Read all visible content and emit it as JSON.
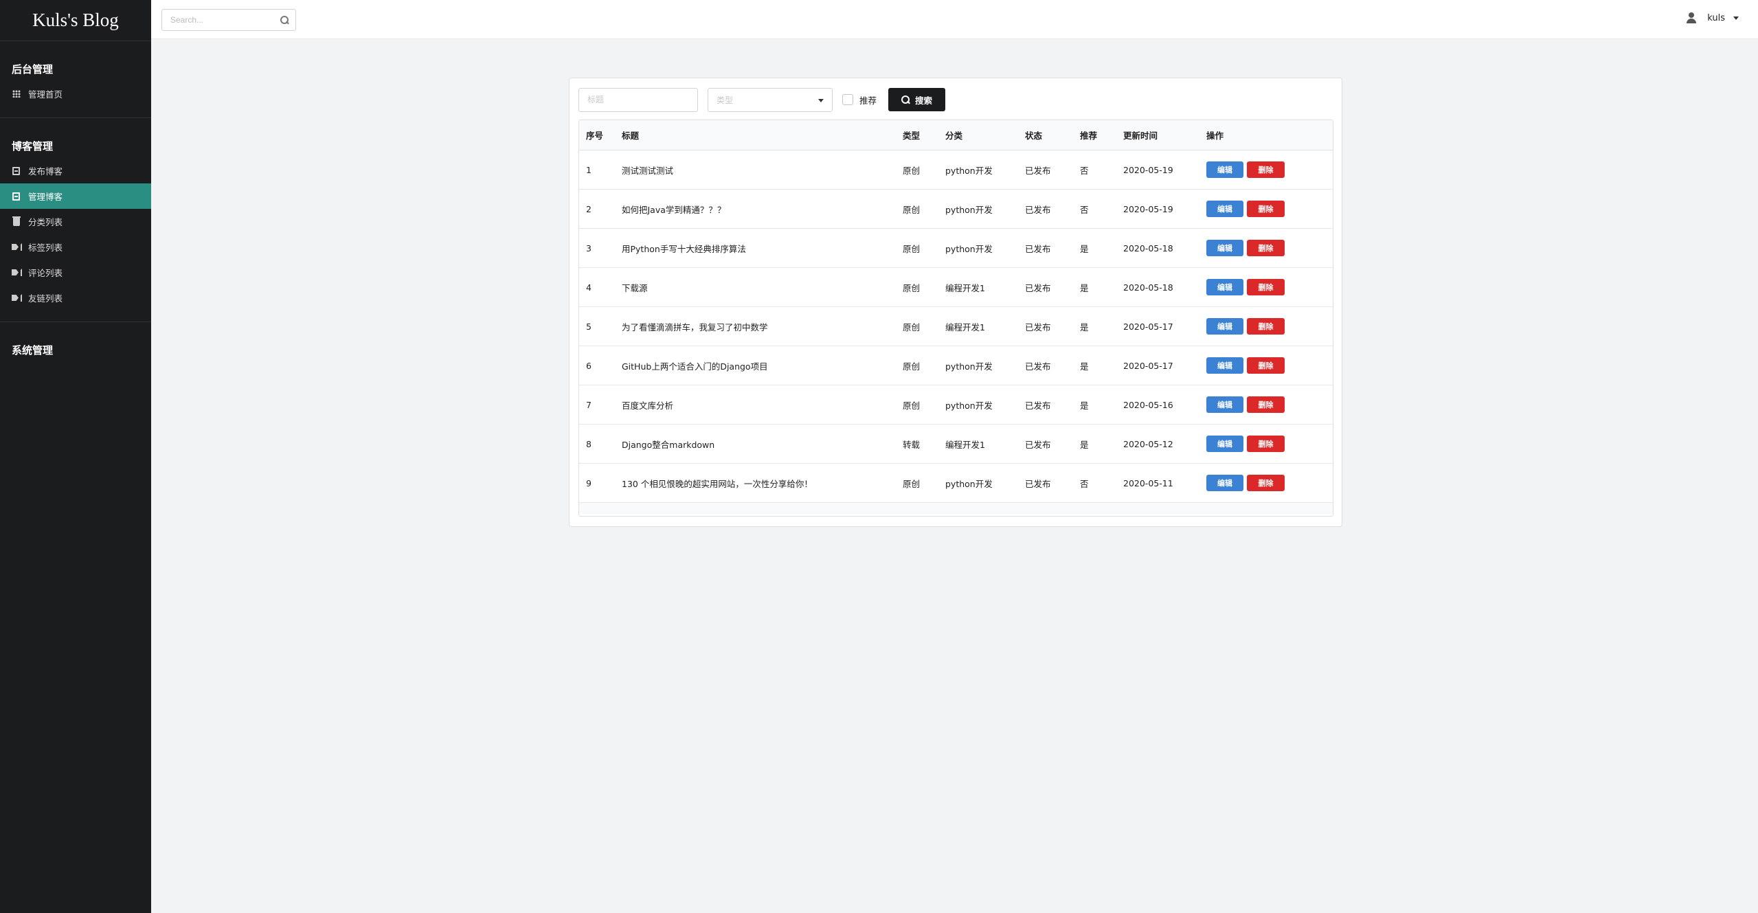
{
  "brand": "Kuls's Blog",
  "sidebar": {
    "sections": [
      {
        "header": "后台管理",
        "items": [
          {
            "label": "管理首页",
            "icon": "grid-icon"
          }
        ]
      },
      {
        "header": "博客管理",
        "items": [
          {
            "label": "发布博客",
            "icon": "book-icon"
          },
          {
            "label": "管理博客",
            "icon": "book-icon",
            "active": true
          },
          {
            "label": "分类列表",
            "icon": "trash-icon"
          },
          {
            "label": "标签列表",
            "icon": "tags-icon"
          },
          {
            "label": "评论列表",
            "icon": "tags-icon"
          },
          {
            "label": "友链列表",
            "icon": "tags-icon"
          }
        ]
      }
    ],
    "system_header": "系统管理"
  },
  "topbar": {
    "search_placeholder": "Search...",
    "username": "kuls"
  },
  "filters": {
    "title_placeholder": "标题",
    "type_placeholder": "类型",
    "recommend_label": "推荐",
    "search_button": "搜索"
  },
  "table": {
    "headers": [
      "序号",
      "标题",
      "类型",
      "分类",
      "状态",
      "推荐",
      "更新时间",
      "操作"
    ],
    "edit_label": "编辑",
    "delete_label": "删除",
    "rows": [
      {
        "id": "1",
        "title": "测试测试测试",
        "type": "原创",
        "category": "python开发",
        "status": "已发布",
        "recommend": "否",
        "updated": "2020-05-19"
      },
      {
        "id": "2",
        "title": "如何把Java学到精通？？？",
        "type": "原创",
        "category": "python开发",
        "status": "已发布",
        "recommend": "否",
        "updated": "2020-05-19"
      },
      {
        "id": "3",
        "title": "用Python手写十大经典排序算法",
        "type": "原创",
        "category": "python开发",
        "status": "已发布",
        "recommend": "是",
        "updated": "2020-05-18"
      },
      {
        "id": "4",
        "title": "下载源",
        "type": "原创",
        "category": "编程开发1",
        "status": "已发布",
        "recommend": "是",
        "updated": "2020-05-18"
      },
      {
        "id": "5",
        "title": "为了看懂滴滴拼车，我复习了初中数学",
        "type": "原创",
        "category": "编程开发1",
        "status": "已发布",
        "recommend": "是",
        "updated": "2020-05-17"
      },
      {
        "id": "6",
        "title": "GitHub上两个适合入门的Django项目",
        "type": "原创",
        "category": "python开发",
        "status": "已发布",
        "recommend": "是",
        "updated": "2020-05-17"
      },
      {
        "id": "7",
        "title": "百度文库分析",
        "type": "原创",
        "category": "python开发",
        "status": "已发布",
        "recommend": "是",
        "updated": "2020-05-16"
      },
      {
        "id": "8",
        "title": "Django整合markdown",
        "type": "转载",
        "category": "编程开发1",
        "status": "已发布",
        "recommend": "是",
        "updated": "2020-05-12"
      },
      {
        "id": "9",
        "title": "130 个相见恨晚的超实用网站，一次性分享给你！",
        "type": "原创",
        "category": "python开发",
        "status": "已发布",
        "recommend": "否",
        "updated": "2020-05-11"
      }
    ]
  },
  "colors": {
    "sidebar_bg": "#1b1c1d",
    "active_item": "#2a8e82",
    "edit_button": "#3b82d4",
    "delete_button": "#db2828"
  }
}
